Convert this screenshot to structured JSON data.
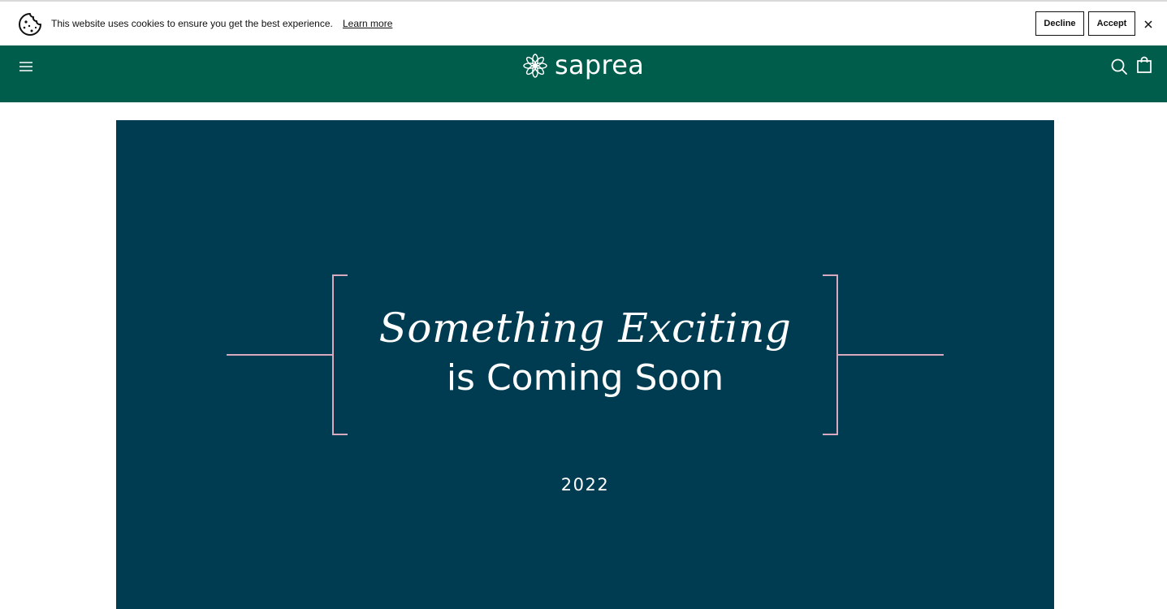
{
  "cookie_bar": {
    "message": "This website uses cookies to ensure you get the best experience.",
    "learn_more": "Learn more",
    "decline_label": "Decline",
    "accept_label": "Accept",
    "close_icon": "close-icon",
    "cookie_icon": "cookie-icon"
  },
  "header": {
    "logo_text": "saprea",
    "background_color": "#005c4b",
    "menu_icon": "hamburger-menu-icon",
    "search_icon": "search-icon",
    "cart_icon": "shopping-bag-icon"
  },
  "banner": {
    "headline_line1": "Something Exciting",
    "headline_line2": "is Coming Soon",
    "year": "2022",
    "background_color": "#003c51",
    "accent_color": "#d9a9bf"
  }
}
